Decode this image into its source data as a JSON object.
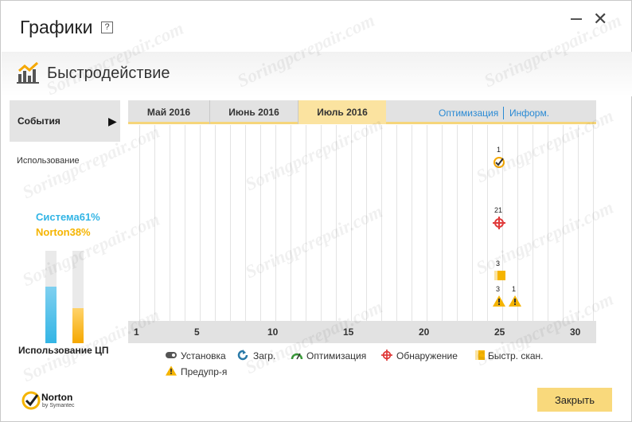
{
  "window": {
    "title": "Графики",
    "help_label": "?",
    "close_glyph": "✕"
  },
  "section": {
    "title": "Быстродействие"
  },
  "sidebar": {
    "events_label": "События",
    "events_arrow": "▶",
    "usage_label": "Использование"
  },
  "cpu": {
    "system_label": "Система61%",
    "norton_label": "Norton38%",
    "system_value": 61,
    "norton_value": 38,
    "caption": "Использование ЦП",
    "system_color": "#33b5e5",
    "norton_color": "#f5a800"
  },
  "tabs": [
    {
      "label": "Май 2016",
      "active": false
    },
    {
      "label": "Июнь 2016",
      "active": false
    },
    {
      "label": "Июль 2016",
      "active": true
    }
  ],
  "links": {
    "optimization": "Оптимизация",
    "info": "Информ."
  },
  "xaxis_ticks": [
    "1",
    "5",
    "10",
    "15",
    "20",
    "25",
    "30"
  ],
  "events": {
    "optimization": {
      "day": 25,
      "count": "1"
    },
    "detection": {
      "day": 25,
      "count": "21"
    },
    "quick_scan": {
      "day": 25,
      "count": "3"
    },
    "warnings": [
      {
        "day": 25,
        "count": "3"
      },
      {
        "day": 26,
        "count": "1"
      }
    ]
  },
  "legend": {
    "install": "Установка",
    "download": "Загр.",
    "optimization": "Оптимизация",
    "detection": "Обнаружение",
    "quick_scan": "Быстр. скан.",
    "warning": "Предупр-я"
  },
  "footer": {
    "brand": "Norton",
    "brand_sub": "by Symantec",
    "close_label": "Закрыть"
  },
  "watermark": "Soringpcrepair.com",
  "colors": {
    "accent_yellow": "#f9d97c",
    "link_blue": "#2a8ad4",
    "detect_red": "#e03a3a",
    "ok_green": "#3a9a3a"
  }
}
